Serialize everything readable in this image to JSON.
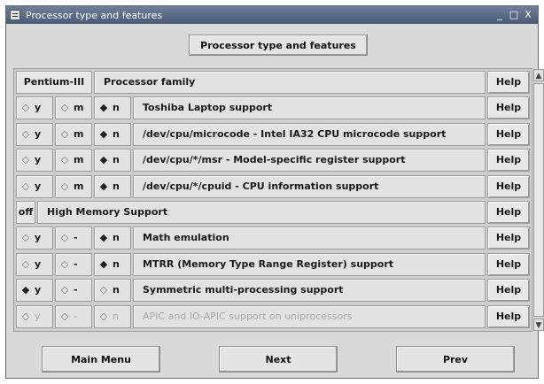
{
  "window": {
    "title": "Processor type and features",
    "controls": {
      "minimize": "_",
      "maximize": "□",
      "close": "X"
    }
  },
  "header_button": "Processor type and features",
  "rows": [
    {
      "kind": "choice",
      "value": "Pentium-III",
      "label": "Processor family",
      "help": "Help"
    },
    {
      "kind": "tristate",
      "y": "y",
      "m": "m",
      "n": "n",
      "selected": "n",
      "label": "Toshiba Laptop support",
      "help": "Help"
    },
    {
      "kind": "tristate",
      "y": "y",
      "m": "m",
      "n": "n",
      "selected": "n",
      "label": "/dev/cpu/microcode - Intel IA32 CPU microcode support",
      "help": "Help"
    },
    {
      "kind": "tristate",
      "y": "y",
      "m": "m",
      "n": "n",
      "selected": "n",
      "label": "/dev/cpu/*/msr - Model-specific register support",
      "help": "Help"
    },
    {
      "kind": "tristate",
      "y": "y",
      "m": "m",
      "n": "n",
      "selected": "n",
      "label": "/dev/cpu/*/cpuid - CPU information support",
      "help": "Help"
    },
    {
      "kind": "choice",
      "value": "off",
      "label": "High Memory Support",
      "help": "Help"
    },
    {
      "kind": "tristate",
      "y": "y",
      "m": "-",
      "n": "n",
      "selected": "n",
      "label": "Math emulation",
      "help": "Help"
    },
    {
      "kind": "tristate",
      "y": "y",
      "m": "-",
      "n": "n",
      "selected": "n",
      "label": "MTRR (Memory Type Range Register) support",
      "help": "Help"
    },
    {
      "kind": "tristate",
      "y": "y",
      "m": "-",
      "n": "n",
      "selected": "y",
      "label": "Symmetric multi-processing support",
      "help": "Help"
    },
    {
      "kind": "tristate",
      "y": "y",
      "m": "-",
      "n": "n",
      "selected": "",
      "dim": true,
      "label": "APIC and IO-APIC support on uniprocessors",
      "help": "Help"
    }
  ],
  "buttons": {
    "main_menu": "Main Menu",
    "next": "Next",
    "prev": "Prev"
  },
  "icons": {
    "radio_selected": "◆",
    "radio_unselected": "◇"
  },
  "colors": {
    "titlebar": "#4a5a76",
    "window_bg": "#d9d9d9"
  }
}
